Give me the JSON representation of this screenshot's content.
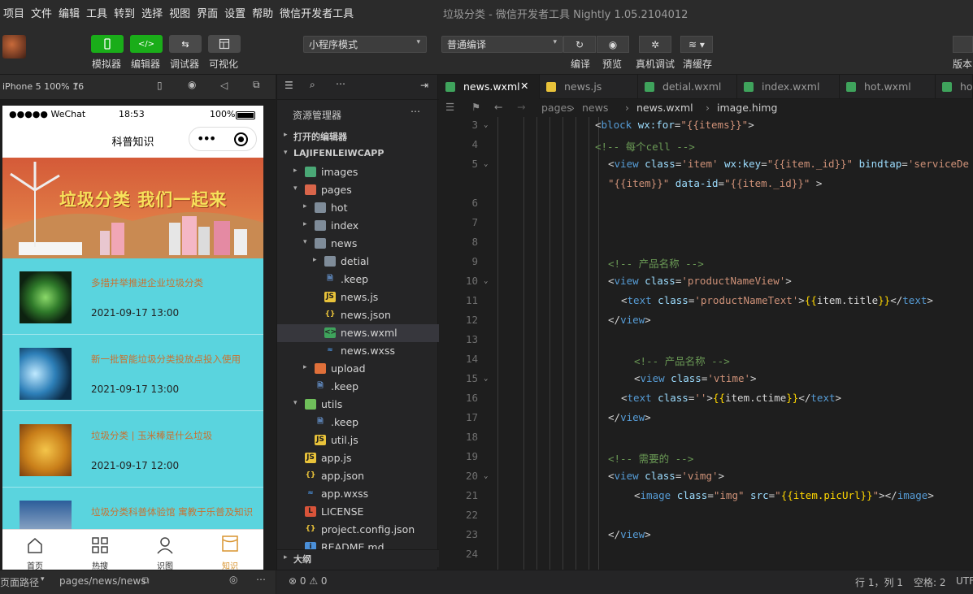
{
  "menubar": [
    "项目",
    "文件",
    "编辑",
    "工具",
    "转到",
    "选择",
    "视图",
    "界面",
    "设置",
    "帮助",
    "微信开发者工具"
  ],
  "window_title": "垃圾分类 - 微信开发者工具 Nightly 1.05.2104012",
  "toolbar": {
    "simulator": "模拟器",
    "editor": "编辑器",
    "debugger": "调试器",
    "visual": "可视化",
    "mode_select": "小程序模式",
    "compile_select": "普通编译",
    "compile": "编译",
    "preview": "预览",
    "real_debug": "真机调试",
    "clear_cache": "清缓存",
    "version": "版本"
  },
  "simbar": {
    "device": "iPhone 5 100% 16"
  },
  "phone": {
    "carrier": "●●●●● WeChat",
    "time": "18:53",
    "battery": "100%",
    "page_title": "科普知识",
    "banner_text": "垃圾分类 我们一起来",
    "news": [
      {
        "title": "多措并举推进企业垃圾分类",
        "time": "2021-09-17 13:00"
      },
      {
        "title": "新一批智能垃圾分类投放点投入使用",
        "time": "2021-09-17 13:00"
      },
      {
        "title": "垃圾分类 | 玉米棒是什么垃圾",
        "time": "2021-09-17 12:00"
      },
      {
        "title": "垃圾分类科普体验馆 寓教于乐普及知识",
        "time": ""
      }
    ],
    "tabs": [
      "首页",
      "热搜",
      "识图",
      "知识"
    ]
  },
  "simfoot": {
    "label": "页面路径",
    "path": "pages/news/news"
  },
  "explorer": {
    "title": "资源管理器",
    "open_editors": "打开的编辑器",
    "project": "LAJIFENLEIWCAPP",
    "outline": "大纲",
    "tree": [
      {
        "name": "images",
        "type": "folder-img",
        "depth": 1,
        "tw": "▸"
      },
      {
        "name": "pages",
        "type": "folder-pages",
        "depth": 1,
        "tw": "▾"
      },
      {
        "name": "hot",
        "type": "folder",
        "depth": 2,
        "tw": "▸"
      },
      {
        "name": "index",
        "type": "folder",
        "depth": 2,
        "tw": "▸"
      },
      {
        "name": "news",
        "type": "folder",
        "depth": 2,
        "tw": "▾"
      },
      {
        "name": "detial",
        "type": "folder",
        "depth": 3,
        "tw": "▸"
      },
      {
        "name": ".keep",
        "type": "file",
        "depth": 3,
        "tw": ""
      },
      {
        "name": "news.js",
        "type": "js",
        "depth": 3,
        "tw": ""
      },
      {
        "name": "news.json",
        "type": "json",
        "depth": 3,
        "tw": ""
      },
      {
        "name": "news.wxml",
        "type": "wxml",
        "depth": 3,
        "tw": "",
        "selected": true
      },
      {
        "name": "news.wxss",
        "type": "wxss",
        "depth": 3,
        "tw": ""
      },
      {
        "name": "upload",
        "type": "folder-up",
        "depth": 2,
        "tw": "▸"
      },
      {
        "name": ".keep",
        "type": "file",
        "depth": 2,
        "tw": ""
      },
      {
        "name": "utils",
        "type": "folder-utils",
        "depth": 1,
        "tw": "▾"
      },
      {
        "name": ".keep",
        "type": "file",
        "depth": 2,
        "tw": ""
      },
      {
        "name": "util.js",
        "type": "js",
        "depth": 2,
        "tw": ""
      },
      {
        "name": "app.js",
        "type": "js",
        "depth": 1,
        "tw": ""
      },
      {
        "name": "app.json",
        "type": "json",
        "depth": 1,
        "tw": ""
      },
      {
        "name": "app.wxss",
        "type": "wxss",
        "depth": 1,
        "tw": ""
      },
      {
        "name": "LICENSE",
        "type": "license",
        "depth": 1,
        "tw": ""
      },
      {
        "name": "project.config.json",
        "type": "json",
        "depth": 1,
        "tw": ""
      },
      {
        "name": "README.md",
        "type": "md",
        "depth": 1,
        "tw": ""
      }
    ]
  },
  "editor": {
    "tabs": [
      {
        "name": "news.wxml",
        "type": "wxml",
        "active": true
      },
      {
        "name": "news.js",
        "type": "js"
      },
      {
        "name": "detial.wxml",
        "type": "wxml"
      },
      {
        "name": "index.wxml",
        "type": "wxml"
      },
      {
        "name": "hot.wxml",
        "type": "wxml"
      },
      {
        "name": "ho",
        "type": "wxml"
      }
    ],
    "breadcrumb": [
      "pages",
      "news",
      "news.wxml",
      "image.himg"
    ],
    "lines": [
      {
        "n": "3",
        "fold": true,
        "indent": 24,
        "seg": [
          [
            "mu",
            "<"
          ],
          [
            "kw",
            "block"
          ],
          [
            "mu",
            " "
          ],
          [
            "at",
            "wx:for"
          ],
          [
            "mu",
            "="
          ],
          [
            "st",
            "\"{{items}}\""
          ],
          [
            "mu",
            ">"
          ]
        ]
      },
      {
        "n": "4",
        "indent": 24,
        "seg": [
          [
            "cm",
            "<!-- 每个cell -->"
          ]
        ]
      },
      {
        "n": "5",
        "fold": true,
        "indent": 26,
        "seg": [
          [
            "mu",
            "<"
          ],
          [
            "kw",
            "view"
          ],
          [
            "mu",
            " "
          ],
          [
            "at",
            "class"
          ],
          [
            "mu",
            "="
          ],
          [
            "st",
            "'item'"
          ],
          [
            "mu",
            " "
          ],
          [
            "at",
            "wx:key"
          ],
          [
            "mu",
            "="
          ],
          [
            "st",
            "\"{{item._id}}\""
          ],
          [
            "mu",
            " "
          ],
          [
            "at",
            "bindtap"
          ],
          [
            "mu",
            "="
          ],
          [
            "st",
            "'serviceDe"
          ]
        ]
      },
      {
        "n": "",
        "indent": 26,
        "seg": [
          [
            "st",
            "\"{{item}}\""
          ],
          [
            "mu",
            " "
          ],
          [
            "at",
            "data-id"
          ],
          [
            "mu",
            "="
          ],
          [
            "st",
            "\"{{item._id}}\""
          ],
          [
            "mu",
            " >"
          ]
        ]
      },
      {
        "n": "6",
        "indent": 0,
        "seg": []
      },
      {
        "n": "7",
        "indent": 0,
        "seg": []
      },
      {
        "n": "8",
        "indent": 0,
        "seg": []
      },
      {
        "n": "9",
        "indent": 26,
        "seg": [
          [
            "cm",
            "<!-- 产品名称 -->"
          ]
        ]
      },
      {
        "n": "10",
        "fold": true,
        "indent": 26,
        "seg": [
          [
            "mu",
            "<"
          ],
          [
            "kw",
            "view"
          ],
          [
            "mu",
            " "
          ],
          [
            "at",
            "class"
          ],
          [
            "mu",
            "="
          ],
          [
            "st",
            "'productNameView'"
          ],
          [
            "mu",
            ">"
          ]
        ]
      },
      {
        "n": "11",
        "indent": 28,
        "seg": [
          [
            "mu",
            "<"
          ],
          [
            "kw",
            "text"
          ],
          [
            "mu",
            " "
          ],
          [
            "at",
            "class"
          ],
          [
            "mu",
            "="
          ],
          [
            "st",
            "'productNameText'"
          ],
          [
            "mu",
            ">"
          ],
          [
            "br",
            "{{"
          ],
          [
            "mu",
            "item.title"
          ],
          [
            "br",
            "}}"
          ],
          [
            "mu",
            "</"
          ],
          [
            "kw",
            "text"
          ],
          [
            "mu",
            ">"
          ]
        ]
      },
      {
        "n": "12",
        "indent": 26,
        "seg": [
          [
            "mu",
            "</"
          ],
          [
            "kw",
            "view"
          ],
          [
            "mu",
            ">"
          ]
        ]
      },
      {
        "n": "13",
        "indent": 0,
        "seg": []
      },
      {
        "n": "14",
        "indent": 30,
        "seg": [
          [
            "cm",
            "<!-- 产品名称 -->"
          ]
        ]
      },
      {
        "n": "15",
        "fold": true,
        "indent": 30,
        "seg": [
          [
            "mu",
            "<"
          ],
          [
            "kw",
            "view"
          ],
          [
            "mu",
            " "
          ],
          [
            "at",
            "class"
          ],
          [
            "mu",
            "="
          ],
          [
            "st",
            "'vtime'"
          ],
          [
            "mu",
            ">"
          ]
        ]
      },
      {
        "n": "16",
        "indent": 28,
        "seg": [
          [
            "mu",
            "<"
          ],
          [
            "kw",
            "text"
          ],
          [
            "mu",
            " "
          ],
          [
            "at",
            "class"
          ],
          [
            "mu",
            "="
          ],
          [
            "st",
            "''"
          ],
          [
            "mu",
            ">"
          ],
          [
            "br",
            "{{"
          ],
          [
            "mu",
            "item.ctime"
          ],
          [
            "br",
            "}}"
          ],
          [
            "mu",
            "</"
          ],
          [
            "kw",
            "text"
          ],
          [
            "mu",
            ">"
          ]
        ]
      },
      {
        "n": "17",
        "indent": 26,
        "seg": [
          [
            "mu",
            "</"
          ],
          [
            "kw",
            "view"
          ],
          [
            "mu",
            ">"
          ]
        ]
      },
      {
        "n": "18",
        "indent": 0,
        "seg": []
      },
      {
        "n": "19",
        "indent": 26,
        "seg": [
          [
            "cm",
            "<!-- 需要的 -->"
          ]
        ]
      },
      {
        "n": "20",
        "fold": true,
        "indent": 26,
        "seg": [
          [
            "mu",
            "<"
          ],
          [
            "kw",
            "view"
          ],
          [
            "mu",
            " "
          ],
          [
            "at",
            "class"
          ],
          [
            "mu",
            "="
          ],
          [
            "st",
            "'vimg'"
          ],
          [
            "mu",
            ">"
          ]
        ]
      },
      {
        "n": "21",
        "indent": 30,
        "seg": [
          [
            "mu",
            "<"
          ],
          [
            "kw",
            "image"
          ],
          [
            "mu",
            " "
          ],
          [
            "at",
            "class"
          ],
          [
            "mu",
            "="
          ],
          [
            "st",
            "\"img\""
          ],
          [
            "mu",
            " "
          ],
          [
            "at",
            "src"
          ],
          [
            "mu",
            "="
          ],
          [
            "st",
            "\""
          ],
          [
            "br",
            "{{item.picUrl}}"
          ],
          [
            "st",
            "\""
          ],
          [
            "mu",
            "></"
          ],
          [
            "kw",
            "image"
          ],
          [
            "mu",
            ">"
          ]
        ]
      },
      {
        "n": "22",
        "indent": 0,
        "seg": []
      },
      {
        "n": "23",
        "indent": 26,
        "seg": [
          [
            "mu",
            "</"
          ],
          [
            "kw",
            "view"
          ],
          [
            "mu",
            ">"
          ]
        ]
      },
      {
        "n": "24",
        "indent": 0,
        "seg": []
      }
    ]
  },
  "statusbar": {
    "problems": "⊗ 0 ⚠ 0",
    "position": "行 1，列 1",
    "spaces": "空格: 2",
    "encoding": "UTF"
  },
  "colors": {
    "accent_green": "#1aad19",
    "selected_row": "#37373d",
    "list_bg": "#5ad4de"
  }
}
